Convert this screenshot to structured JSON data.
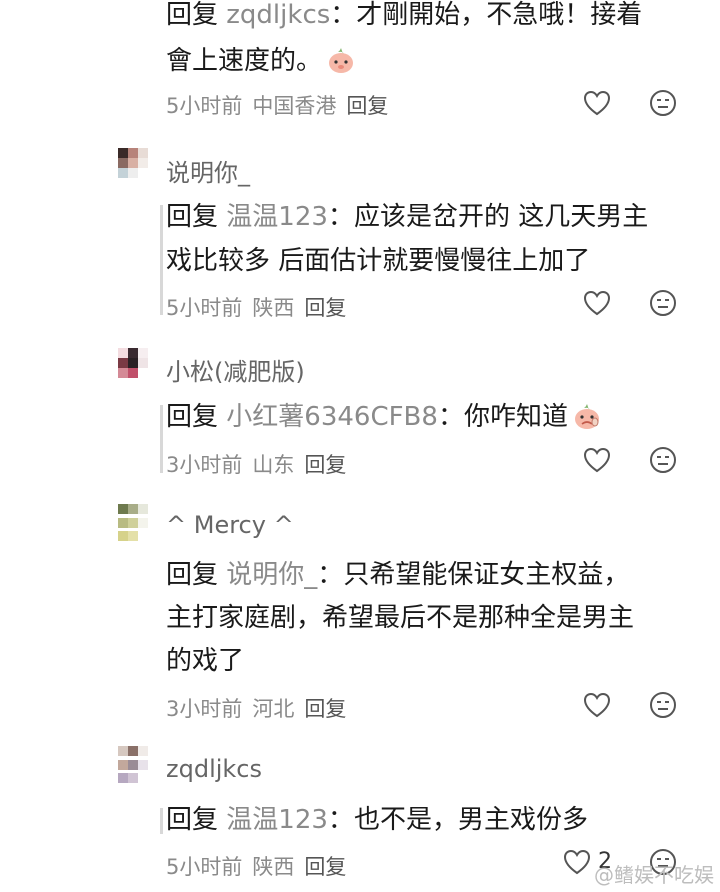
{
  "comments": [
    {
      "username": "",
      "reply_keyword": "回复",
      "reply_target": "zqdljkcs",
      "reply_sep": "：",
      "reply_lines": [
        "才剛開始，不急哦！接着",
        "會上速度的。"
      ],
      "time": "5小时前",
      "location": "中国香港",
      "reply_action": "回复",
      "likes": ""
    },
    {
      "username": "说明你_",
      "reply_keyword": "回复",
      "reply_target": "温温123",
      "reply_sep": "：",
      "reply_lines": [
        "应该是岔开的 这几天男主",
        "戏比较多 后面估计就要慢慢往上加了"
      ],
      "time": "5小时前",
      "location": "陕西",
      "reply_action": "回复",
      "likes": ""
    },
    {
      "username": "小松(减肥版)",
      "reply_keyword": "回复",
      "reply_target": "小红薯6346CFB8",
      "reply_sep": "：",
      "reply_lines": [
        "你咋知道"
      ],
      "time": "3小时前",
      "location": "山东",
      "reply_action": "回复",
      "likes": ""
    },
    {
      "username": "^ Mercy ^",
      "reply_keyword": "回复",
      "reply_target": "说明你_",
      "reply_sep": "：",
      "reply_lines": [
        "只希望能保证女主权益，",
        "主打家庭剧，希望最后不是那种全是男主",
        "的戏了"
      ],
      "time": "3小时前",
      "location": "河北",
      "reply_action": "回复",
      "likes": ""
    },
    {
      "username": "zqdljkcs",
      "reply_keyword": "回复",
      "reply_target": "温温123",
      "reply_sep": "：",
      "reply_lines": [
        "也不是，男主戏份多"
      ],
      "time": "5小时前",
      "location": "陕西",
      "reply_action": "回复",
      "likes": "2"
    }
  ],
  "icons": {
    "like": "heart-outline-icon",
    "dislike": "neutral-face-icon",
    "emoji": "peach-pig-emoji"
  },
  "watermark": "@鳍娱不吃娱",
  "colors": {
    "text": "#1a1a1a",
    "muted": "#8a8a8a",
    "username": "#666666",
    "pig": "#f6b8a8"
  }
}
